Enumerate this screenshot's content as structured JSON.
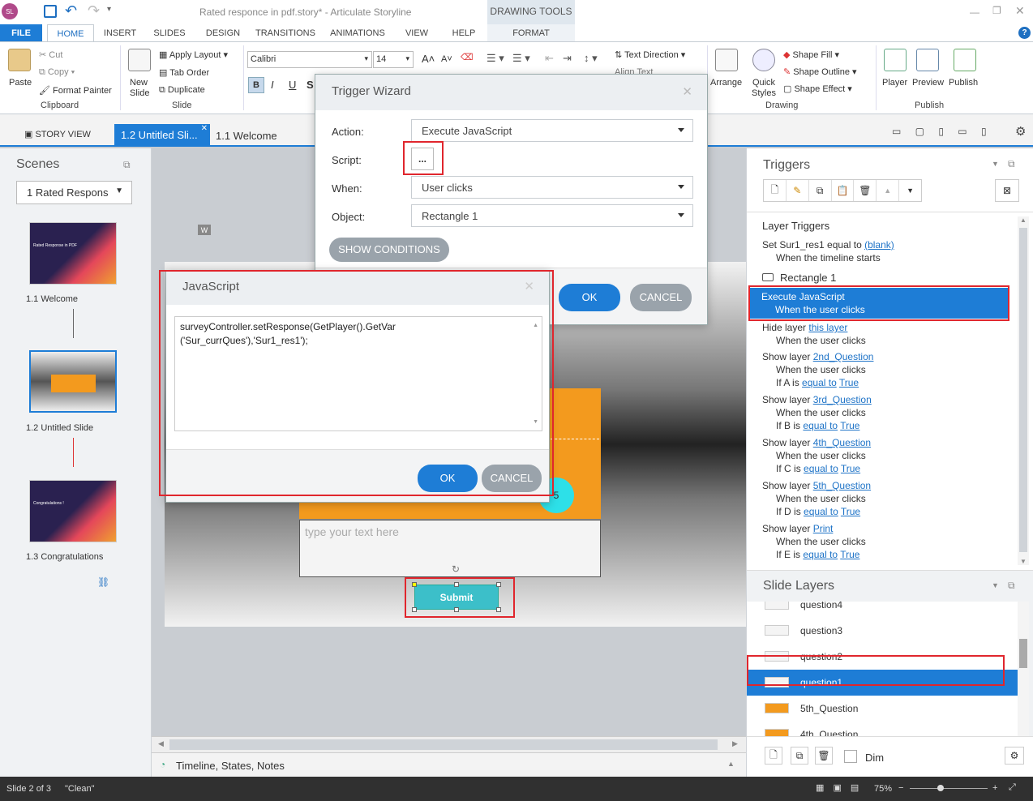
{
  "window": {
    "title": "Rated responce in pdf.story* - Articulate Storyline",
    "drawing_tools": "DRAWING TOOLS",
    "format_tab": "FORMAT",
    "logo": "SL"
  },
  "ribbon_tabs": [
    "FILE",
    "HOME",
    "INSERT",
    "SLIDES",
    "DESIGN",
    "TRANSITIONS",
    "ANIMATIONS",
    "VIEW",
    "HELP"
  ],
  "ribbon": {
    "paste": "Paste",
    "cut": "Cut",
    "copy": "Copy",
    "format_painter": "Format Painter",
    "clipboard": "Clipboard",
    "new_slide": "New Slide",
    "apply_layout": "Apply Layout",
    "tab_order": "Tab Order",
    "duplicate": "Duplicate",
    "slide": "Slide",
    "font": "Calibri",
    "size": "14",
    "text_direction": "Text Direction",
    "align_text": "Align Text",
    "arrange": "Arrange",
    "quick_styles": "Quick Styles",
    "shape_fill": "Shape Fill",
    "shape_outline": "Shape Outline",
    "shape_effect": "Shape Effect",
    "drawing": "Drawing",
    "player": "Player",
    "preview": "Preview",
    "publish_btn": "Publish",
    "publish": "Publish",
    "bold": "B",
    "italic": "I",
    "underline": "U",
    "shadow": "S"
  },
  "doc_tabs": {
    "story_view": "STORY VIEW",
    "active": "1.2 Untitled Sli...",
    "other": "1.1 Welcome"
  },
  "scenes": {
    "title": "Scenes",
    "dropdown": "1 Rated Respons",
    "slides": [
      {
        "label": "1.1 Welcome",
        "thumb_title": "Rated Response in PDF"
      },
      {
        "label": "1.2 Untitled Slide",
        "thumb_title": ""
      },
      {
        "label": "1.3 Congratulations",
        "thumb_title": "Congratulations !"
      }
    ]
  },
  "canvas": {
    "text_placeholder": "type your text here",
    "submit": "Submit",
    "w_marker": "W",
    "rating_label": "5",
    "timeline": "Timeline, States, Notes"
  },
  "trigger_wizard": {
    "title": "Trigger Wizard",
    "action_label": "Action:",
    "action_value": "Execute JavaScript",
    "script_label": "Script:",
    "script_btn": "...",
    "when_label": "When:",
    "when_value": "User clicks",
    "object_label": "Object:",
    "object_value": "Rectangle 1",
    "show_conditions": "SHOW CONDITIONS",
    "ok": "OK",
    "cancel": "CANCEL"
  },
  "js_dialog": {
    "title": "JavaScript",
    "code_line1": "surveyController.setResponse(GetPlayer().GetVar",
    "code_line2": "('Sur_currQues'),'Sur1_res1');",
    "ok": "OK",
    "cancel": "CANCEL"
  },
  "triggers": {
    "title": "Triggers",
    "layer_triggers": "Layer Triggers",
    "set_line": "Set Sur1_res1 equal to",
    "blank": "(blank)",
    "timeline_starts": "When the timeline starts",
    "rect": "Rectangle 1",
    "exec": "Execute JavaScript",
    "exec_when": "When the user clicks",
    "hide": "Hide layer",
    "this_layer": "this layer",
    "user_clicks": "When the user clicks",
    "show": "Show layer",
    "items": [
      {
        "link": "2nd_Question",
        "cond_var": "A",
        "op": "equal to",
        "val": "True"
      },
      {
        "link": "3rd_Question",
        "cond_var": "B",
        "op": "equal to",
        "val": "True"
      },
      {
        "link": "4th_Question",
        "cond_var": "C",
        "op": "equal to",
        "val": "True"
      },
      {
        "link": "5th_Question",
        "cond_var": "D",
        "op": "equal to",
        "val": "True"
      },
      {
        "link": "Print",
        "cond_var": "E",
        "op": "equal to",
        "val": "True"
      }
    ],
    "if": "If",
    "is": "is"
  },
  "slide_layers": {
    "title": "Slide Layers",
    "items": [
      "question4",
      "question3",
      "question2",
      "question1",
      "5th_Question",
      "4th_Question"
    ],
    "dim": "Dim"
  },
  "status": {
    "slide": "Slide 2 of 3",
    "theme": "\"Clean\"",
    "zoom": "75%"
  }
}
